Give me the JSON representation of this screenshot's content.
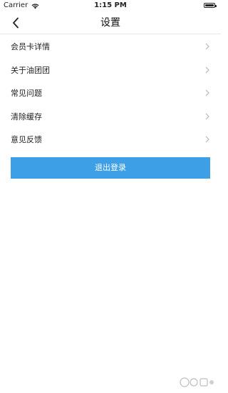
{
  "status_bar": {
    "carrier": "Carrier",
    "time": "1:15 PM",
    "battery_level": 1.0,
    "wifi_icon": "wifi-icon"
  },
  "nav": {
    "title": "设置",
    "back_icon": "chevron-left-icon"
  },
  "menu": {
    "items": [
      {
        "label": "会员卡详情"
      },
      {
        "label": "关于油团团"
      },
      {
        "label": "常见问题"
      },
      {
        "label": "清除缓存"
      },
      {
        "label": "意见反馈"
      }
    ],
    "chevron_icon": "chevron-right-icon"
  },
  "logout": {
    "label": "退出登录",
    "color": "#3d9fe6"
  }
}
